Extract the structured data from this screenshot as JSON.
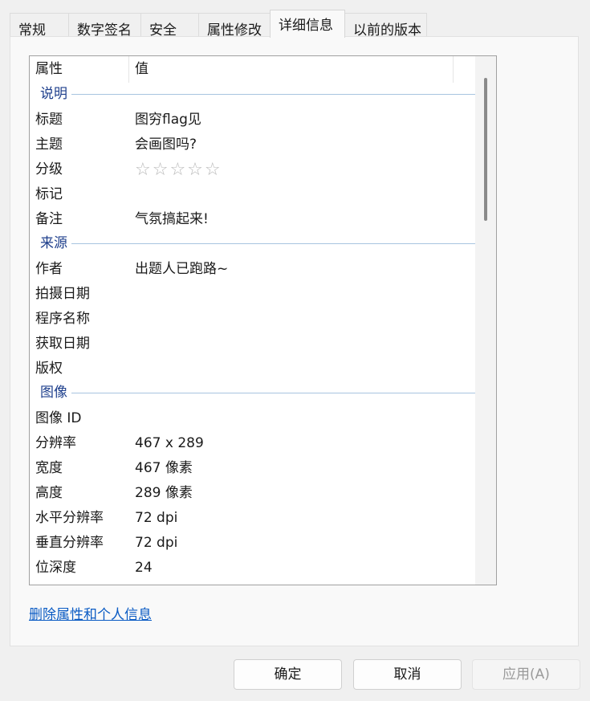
{
  "tabs": [
    {
      "label": "常规"
    },
    {
      "label": "数字签名"
    },
    {
      "label": "安全"
    },
    {
      "label": "属性修改"
    },
    {
      "label": "详细信息"
    },
    {
      "label": "以前的版本"
    }
  ],
  "active_tab": "详细信息",
  "list": {
    "header": {
      "property": "属性",
      "value": "值"
    },
    "groups": {
      "description": {
        "title": "说明",
        "rows": [
          {
            "key": "标题",
            "value": "图穷flag见"
          },
          {
            "key": "主题",
            "value": "会画图吗?"
          },
          {
            "key": "分级",
            "value": "☆☆☆☆☆",
            "rating": 0
          },
          {
            "key": "标记",
            "value": ""
          },
          {
            "key": "备注",
            "value": "气氛搞起来!"
          }
        ]
      },
      "origin": {
        "title": "来源",
        "rows": [
          {
            "key": "作者",
            "value": "出题人已跑路~"
          },
          {
            "key": "拍摄日期",
            "value": ""
          },
          {
            "key": "程序名称",
            "value": ""
          },
          {
            "key": "获取日期",
            "value": ""
          },
          {
            "key": "版权",
            "value": ""
          }
        ]
      },
      "image": {
        "title": "图像",
        "rows": [
          {
            "key": "图像 ID",
            "value": ""
          },
          {
            "key": "分辨率",
            "value": "467 x 289"
          },
          {
            "key": "宽度",
            "value": "467 像素"
          },
          {
            "key": "高度",
            "value": "289 像素"
          },
          {
            "key": "水平分辨率",
            "value": "72 dpi"
          },
          {
            "key": "垂直分辨率",
            "value": "72 dpi"
          },
          {
            "key": "位深度",
            "value": "24"
          }
        ]
      }
    }
  },
  "remove_link": "删除属性和个人信息",
  "buttons": {
    "ok": "确定",
    "cancel": "取消",
    "apply": "应用(A)"
  },
  "colors": {
    "group_title": "#1e3f8c",
    "link": "#0a5bc4",
    "group_line": "#a8c4e0"
  }
}
